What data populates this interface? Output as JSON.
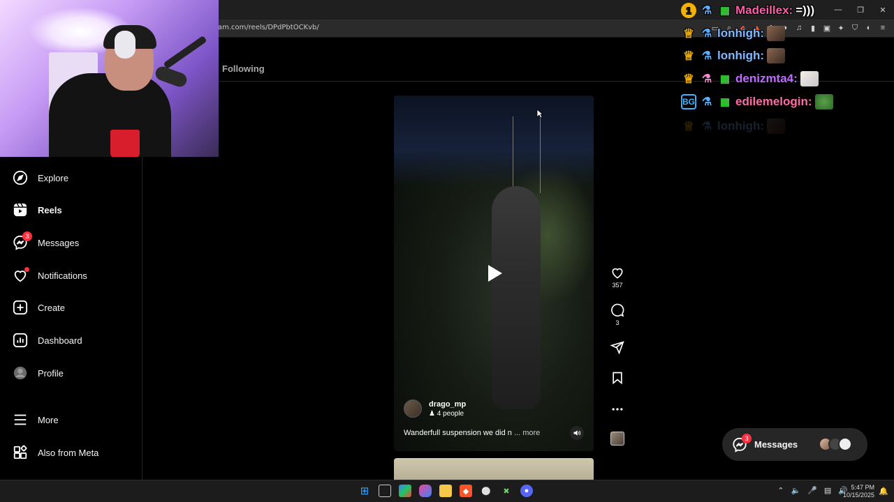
{
  "browser": {
    "url": "am.com/reels/DPdPbtOCKvb/",
    "window_controls": [
      "—",
      "❐",
      "✕"
    ],
    "toolbar_icons": [
      "screen-cast-icon",
      "zoom-icon",
      "brave-shield-icon",
      "brave-rewards-icon",
      "extensions-icon",
      "profile-avatar-icon",
      "music-icon",
      "sidebar-icon",
      "wallet-icon",
      "leo-icon",
      "vpn-icon",
      "bookmarks-icon",
      "menu-icon"
    ]
  },
  "tabs": {
    "following_label": "Following"
  },
  "sidebar": {
    "items": [
      {
        "label": "Explore",
        "icon": "compass-icon"
      },
      {
        "label": "Reels",
        "icon": "reels-icon",
        "active": true
      },
      {
        "label": "Messages",
        "icon": "messenger-icon",
        "badge": "3"
      },
      {
        "label": "Notifications",
        "icon": "heart-icon",
        "dot": true
      },
      {
        "label": "Create",
        "icon": "plus-square-icon"
      },
      {
        "label": "Dashboard",
        "icon": "dashboard-icon"
      },
      {
        "label": "Profile",
        "icon": "profile-avatar-icon"
      },
      {
        "label": "More",
        "icon": "hamburger-icon"
      },
      {
        "label": "Also from Meta",
        "icon": "meta-apps-icon"
      }
    ]
  },
  "reel": {
    "username": "drago_mp",
    "people": "4 people",
    "caption": "Wanderfull suspension we did n",
    "more_label": "... more",
    "likes": "357",
    "comments": "3"
  },
  "messages_pill": {
    "label": "Messages",
    "badge": "3"
  },
  "chat": [
    {
      "user": "Madeillex:",
      "message": "=)))",
      "color": "#ff5ba8",
      "badges": [
        "1",
        "robot",
        "gift"
      ]
    },
    {
      "user": "lonhigh:",
      "message": "",
      "color": "#7fb8ff",
      "badges": [
        "crown",
        "robot"
      ]
    },
    {
      "user": "lonhigh:",
      "message": "",
      "color": "#7fb8ff",
      "badges": [
        "crown",
        "robot"
      ]
    },
    {
      "user": "denizmta4:",
      "message": "",
      "color": "#c06bff",
      "badges": [
        "crown",
        "pink",
        "gift"
      ]
    },
    {
      "user": "edilemelogin:",
      "message": "",
      "color": "#ff6aa6",
      "badges": [
        "bg",
        "robot",
        "gift"
      ]
    },
    {
      "user": "lonhigh:",
      "message": "",
      "color": "#7fb8ff",
      "badges": [
        "crown",
        "robot"
      ]
    }
  ],
  "taskbar": {
    "time": "5:47 PM",
    "date": "10/15/2025",
    "tray_icons": [
      "chevron-up-icon",
      "speaker-icon",
      "mic-icon",
      "network-icon",
      "volume-icon"
    ],
    "apps": [
      "windows-start-icon",
      "file-manager-icon",
      "m365-icon",
      "copilot-icon",
      "explorer-folder-icon",
      "brave-browser-icon",
      "steam-icon",
      "xbox-icon",
      "discord-icon"
    ]
  }
}
